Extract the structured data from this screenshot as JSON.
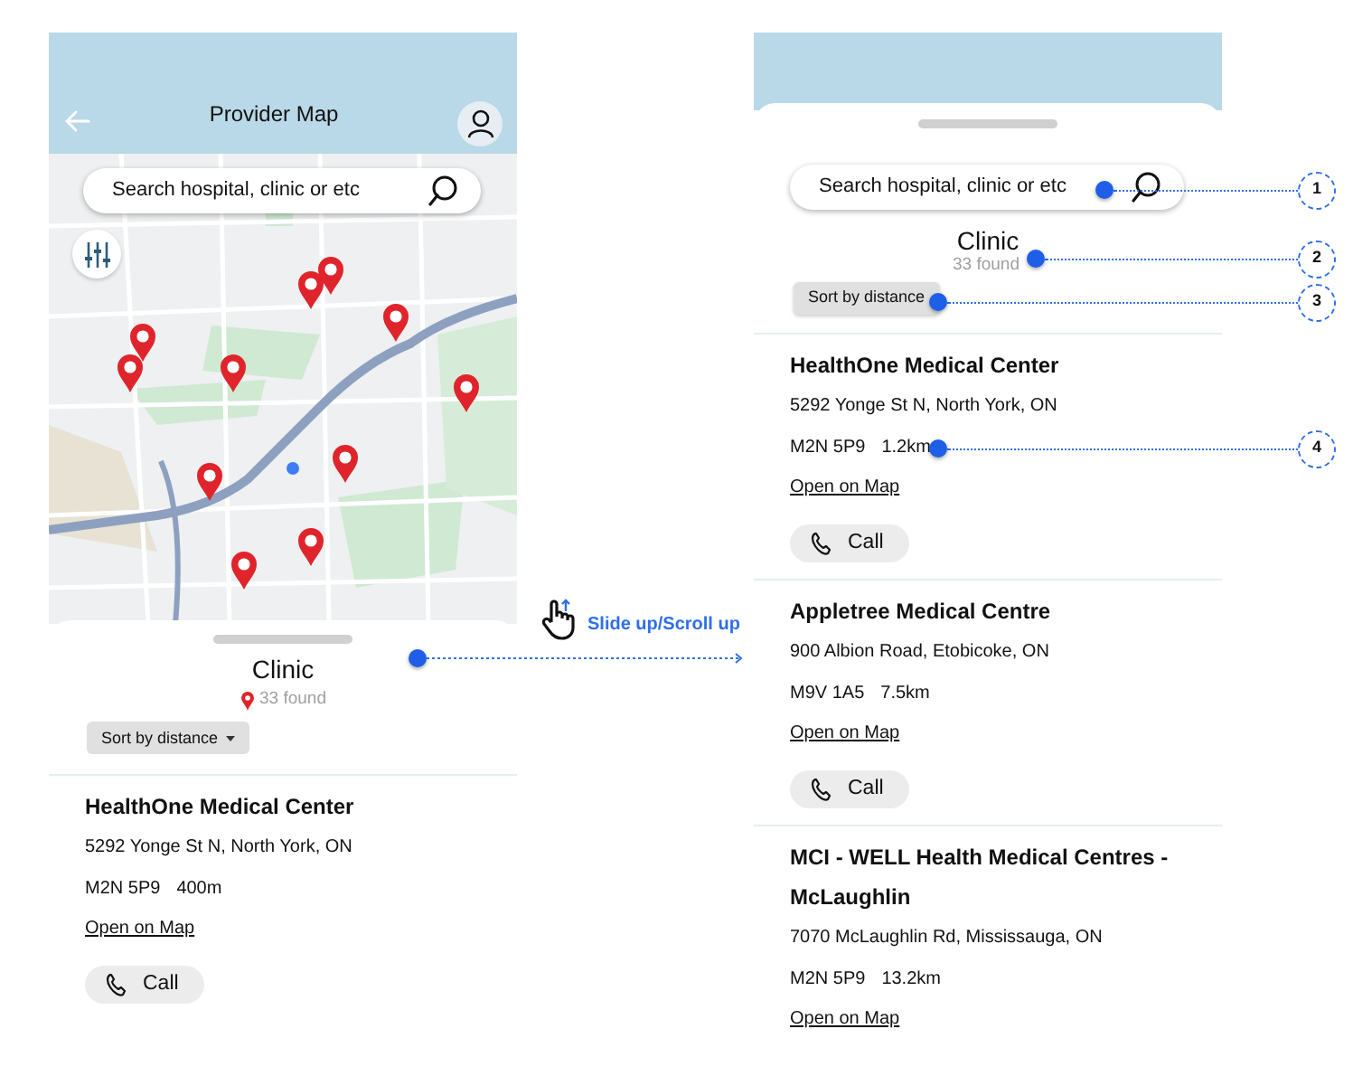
{
  "screens": [
    {
      "kind": "map",
      "header": {
        "title": "Provider Map"
      },
      "search": {
        "placeholder": "Search hospital, clinic or etc"
      },
      "sheet": {
        "title": "Clinic",
        "count": "33 found",
        "sort": "Sort by distance"
      },
      "providers": [
        {
          "name": "HealthOne Medical Center",
          "address": "5292 Yonge St N, North York, ON",
          "postal": "M2N 5P9",
          "distance": "400m",
          "link": "Open on Map",
          "call": "Call"
        }
      ]
    },
    {
      "kind": "expanded",
      "search": {
        "placeholder": "Search hospital, clinic or etc"
      },
      "sheet": {
        "title": "Clinic",
        "count": "33 found",
        "sort": "Sort by distance"
      },
      "providers": [
        {
          "name": "HealthOne Medical Center",
          "address": "5292 Yonge St N, North York, ON",
          "postal": "M2N 5P9",
          "distance": "1.2km",
          "link": "Open on Map",
          "call": "Call"
        },
        {
          "name": "Appletree Medical Centre",
          "address": "900 Albion Road, Etobicoke, ON",
          "postal": "M9V 1A5",
          "distance": "7.5km",
          "link": "Open on Map",
          "call": "Call"
        },
        {
          "name": "MCI - WELL Health Medical Centres - McLaughlin",
          "address": "7070 McLaughlin Rd, Mississauga, ON",
          "postal": "M2N 5P9",
          "distance": "13.2km",
          "link": "Open on Map"
        }
      ]
    }
  ],
  "gesture": {
    "label": "Slide up/Scroll up"
  },
  "callouts": [
    {
      "number": "1"
    },
    {
      "number": "2"
    },
    {
      "number": "3"
    },
    {
      "number": "4"
    }
  ]
}
